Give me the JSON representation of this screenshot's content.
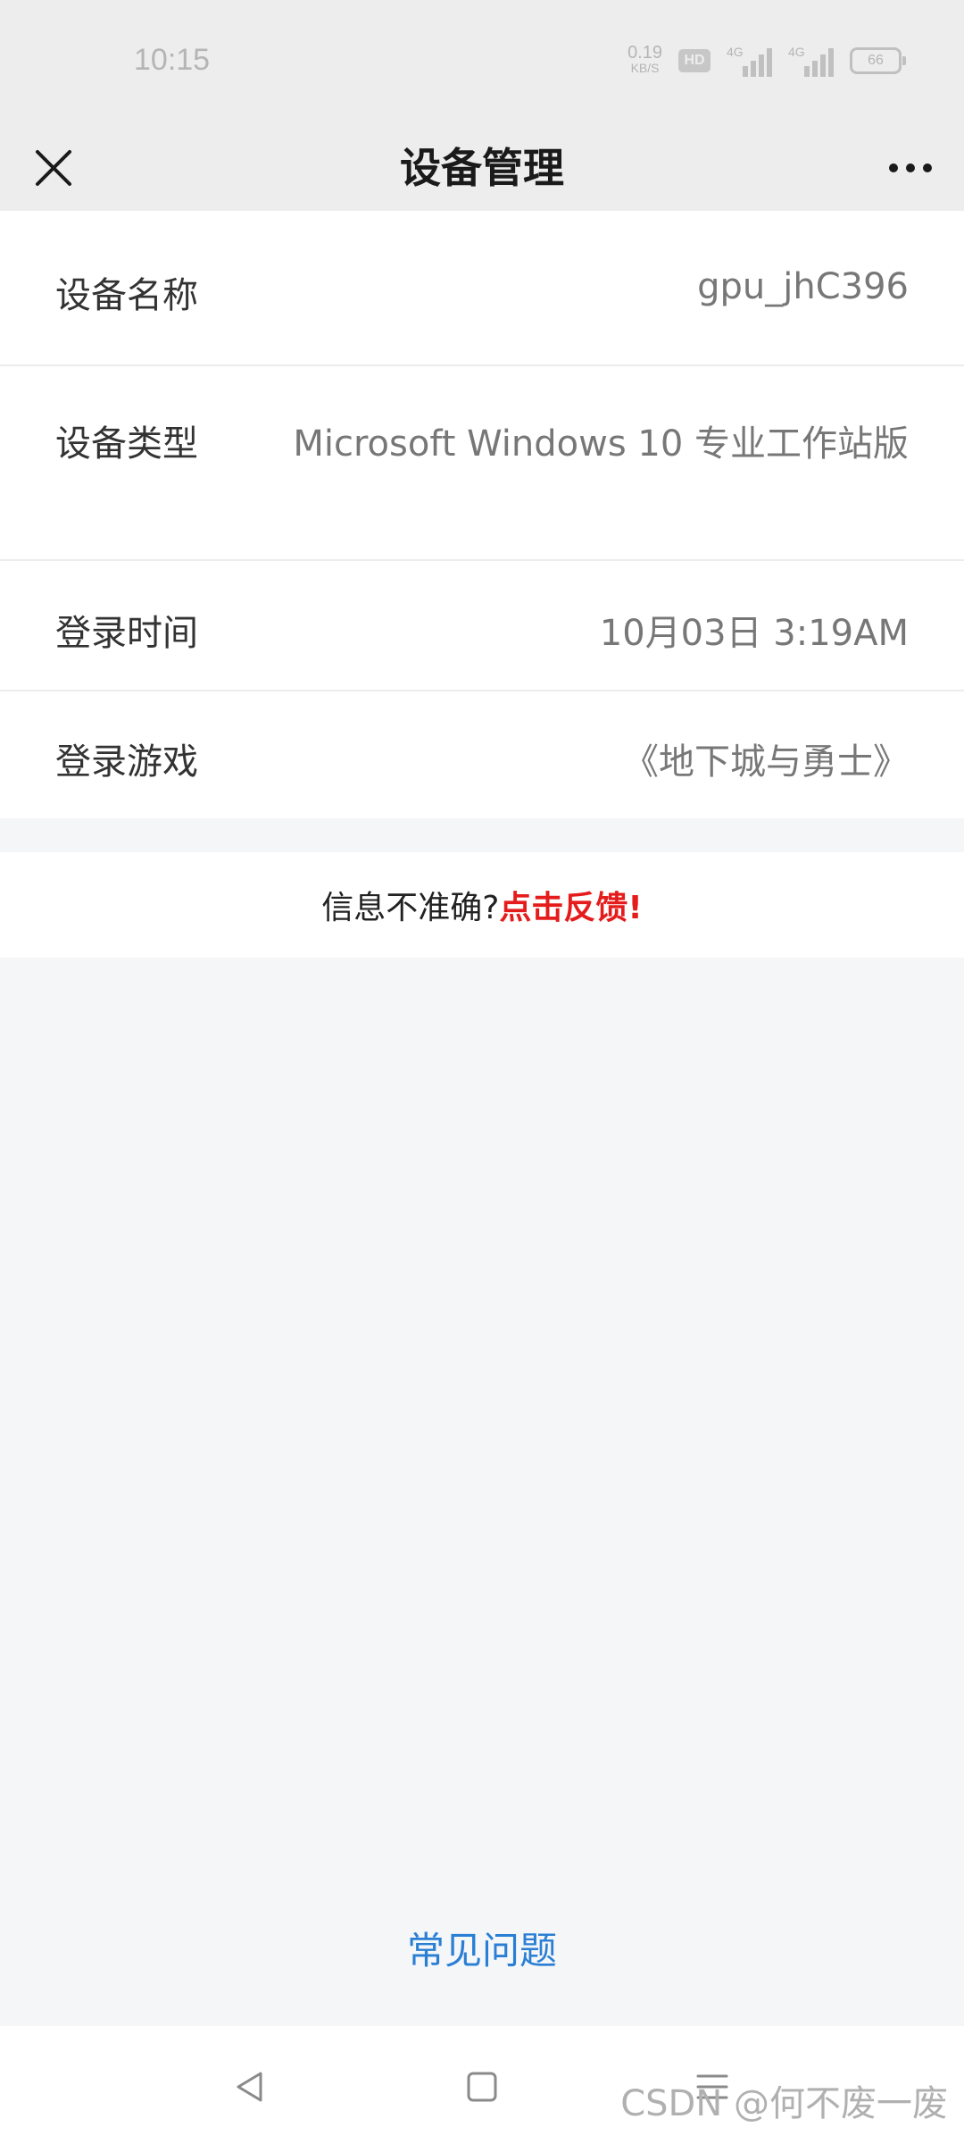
{
  "status_bar": {
    "time": "10:15",
    "net_speed_value": "0.19",
    "net_speed_unit": "KB/S",
    "hd_badge": "HD",
    "signal_1_label": "4G",
    "signal_2_label": "4G",
    "battery_level": "66",
    "color": "#b5b5b5"
  },
  "nav_bar": {
    "title": "设备管理",
    "close_icon": "close-icon",
    "more_icon": "more-icon"
  },
  "device_info": [
    {
      "label": "设备名称",
      "value": "gpu_jhC396"
    },
    {
      "label": "设备类型",
      "value": "Microsoft Windows 10 专业工作站版"
    },
    {
      "label": "登录时间",
      "value": "10月03日 3:19AM"
    },
    {
      "label": "登录游戏",
      "value": "《地下城与勇士》"
    }
  ],
  "feedback": {
    "question": "信息不准确?",
    "link": "点击反馈!"
  },
  "faq": {
    "label": "常见问题"
  },
  "system_nav": {
    "back_icon": "back-triangle-icon",
    "home_icon": "home-square-icon",
    "menu_icon": "menu-lines-icon"
  },
  "watermark": "CSDN @何不废一废",
  "colors": {
    "accent_red": "#e51c1c",
    "link_blue": "#2a7fd4",
    "header_bg": "#ededed",
    "page_bg": "#f5f6f8"
  }
}
